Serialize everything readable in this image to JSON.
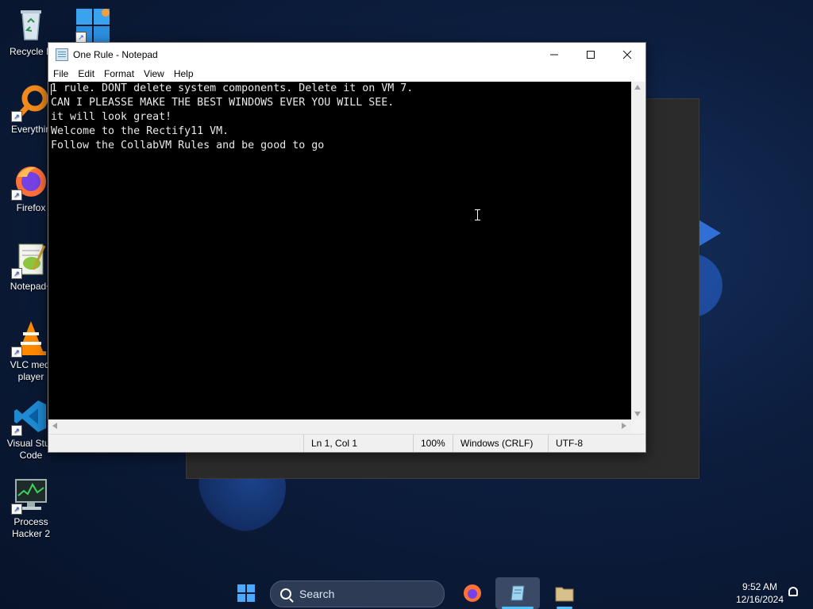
{
  "desktop": {
    "icons": [
      {
        "label": "Recycle B",
        "icon": "recycle-bin-icon"
      },
      {
        "label": "Everythin",
        "icon": "everything-search-icon"
      },
      {
        "label": "Firefox",
        "icon": "firefox-icon"
      },
      {
        "label": "Notepad+",
        "icon": "notepad-plus-plus-icon"
      },
      {
        "label": "VLC media player",
        "line1": "VLC medi",
        "line2": "player",
        "icon": "vlc-icon"
      },
      {
        "label": "Visual Studio Code",
        "line1": "Visual Stud",
        "line2": "Code",
        "icon": "vscode-icon"
      },
      {
        "label": "Process Hacker 2",
        "line1": "Process",
        "line2": "Hacker 2",
        "icon": "process-hacker-icon"
      }
    ],
    "top_icon": "windows-app-icon"
  },
  "notepad": {
    "title": "One Rule - Notepad",
    "menu": [
      "File",
      "Edit",
      "Format",
      "View",
      "Help"
    ],
    "lines": [
      "1 rule. DONT delete system components. Delete it on VM 7.",
      "CAN I PLEASSE MAKE THE BEST WINDOWS EVER YOU WILL SEE.",
      "it will look great!",
      "Welcome to the Rectify11 VM.",
      "Follow the CollabVM Rules and be good to go"
    ],
    "status": {
      "position": "Ln 1, Col 1",
      "zoom": "100%",
      "line_ending": "Windows (CRLF)",
      "encoding": "UTF-8"
    }
  },
  "taskbar": {
    "search_placeholder": "Search",
    "time": "9:52 AM",
    "date": "12/16/2024"
  }
}
